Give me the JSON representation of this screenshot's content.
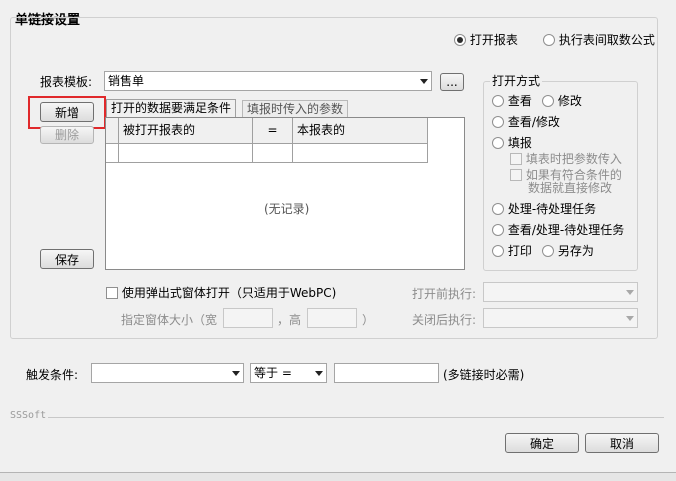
{
  "dialog": {
    "title": "单链接设置",
    "top_radio": {
      "open_report": "打开报表",
      "exec_formula": "执行表间取数公式",
      "selected": "open_report"
    },
    "template": {
      "label": "报表模板:",
      "value": "销售单",
      "browse_label": "..."
    },
    "buttons": {
      "add": "新增",
      "delete": "删除",
      "save": "保存",
      "ok": "确定",
      "cancel": "取消"
    },
    "tabs": [
      {
        "label": "打开的数据要满足条件",
        "active": true
      },
      {
        "label": "填报时传入的参数",
        "active": false
      }
    ],
    "grid": {
      "headers": [
        "被打开报表的",
        "=",
        "本报表的"
      ],
      "empty_text": "(无记录)"
    },
    "open_mode": {
      "title": "打开方式",
      "options": {
        "view": "查看",
        "edit": "修改",
        "view_edit": "查看/修改",
        "fill": "填报",
        "pass_params": "填表时把参数传入",
        "direct_edit_line1": "如果有符合条件的",
        "direct_edit_line2": "数据就直接修改",
        "process": "处理-待处理任务",
        "view_process": "查看/处理-待处理任务",
        "print": "打印",
        "save_as": "另存为"
      }
    },
    "popup": {
      "checkbox_label": "使用弹出式窗体打开（只适用于WebPC)",
      "size_label": "指定窗体大小（宽",
      "height_label": "，高",
      "close_paren": "）"
    },
    "before_exec_label": "打开前执行:",
    "after_exec_label": "关闭后执行:",
    "trigger": {
      "label": "触发条件:",
      "operator": "等于 =",
      "note": "(多链接时必需)"
    },
    "footer_brand": "SSSoft"
  }
}
